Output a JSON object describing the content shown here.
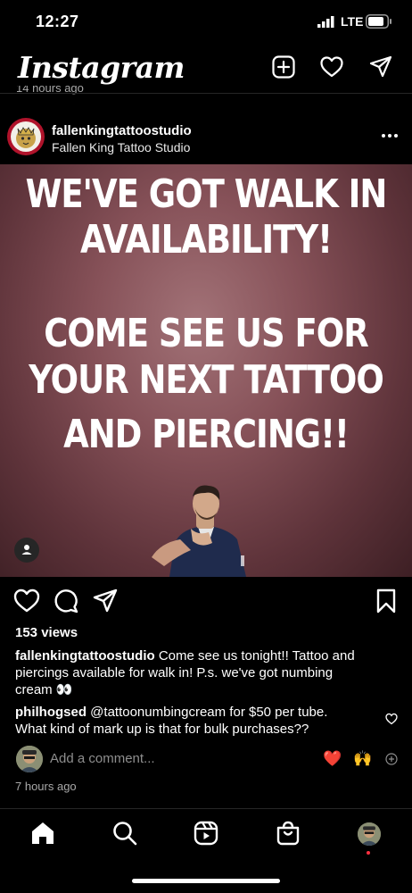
{
  "status_bar": {
    "time": "12:27",
    "network": "LTE"
  },
  "header": {
    "logo": "Instagram",
    "icons": [
      "new-post-icon",
      "heart-icon",
      "direct-message-icon"
    ]
  },
  "previous_post_time": "14 hours ago",
  "post": {
    "username": "fallenkingtattoostudio",
    "full_name": "Fallen King Tattoo Studio",
    "image_text": [
      "WE'VE GOT WALK IN",
      "AVAILABILITY!",
      "COME SEE US FOR",
      "YOUR NEXT TATTOO",
      "AND PIERCING!!"
    ],
    "views": "153 views",
    "caption_user": "fallenkingtattoostudio",
    "caption_lines": [
      "Come see us tonight!! Tattoo and",
      "piercings available for walk in! P.s. we've got numbing",
      "cream 👀"
    ],
    "comment": {
      "user": "philhogsed",
      "text_line1": "@tattoonumbingcream  for $50 per tube.",
      "text_line2": "What kind of mark up is that for bulk purchases??"
    },
    "add_comment_placeholder": "Add a comment...",
    "quick_reactions": [
      "❤️",
      "🙌"
    ],
    "time": "7 hours ago"
  },
  "colors": {
    "background": "#000000",
    "secondary_text": "#a8a8a8",
    "notification_dot": "#ff3040"
  },
  "bottom_nav": [
    "home-icon",
    "search-icon",
    "reels-icon",
    "shop-icon",
    "profile-avatar"
  ]
}
